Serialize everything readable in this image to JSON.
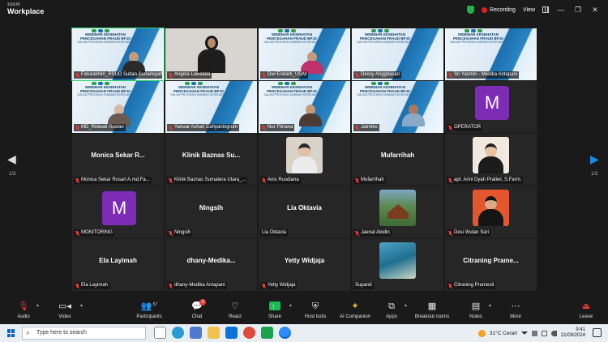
{
  "window": {
    "brand_line1": "zoom",
    "brand_line2": "Workplace",
    "recording_label": "Recording",
    "view_label": "View",
    "minimize_glyph": "—",
    "maximize_glyph": "❐",
    "close_glyph": "✕"
  },
  "navigation": {
    "left_arrow": "◀",
    "right_arrow": "▶",
    "page_left": "1/3",
    "page_right": "1/3"
  },
  "banner": {
    "line1": "WEBINAR KESEHATAN",
    "line2": "PENCEGAHAN FRAUD BPJS",
    "line3": "DALAM PROGRAM JAMINAN KESEHATAN"
  },
  "tiles": [
    {
      "name": "Faturakhim_RSUD Sultan Suriansyah"
    },
    {
      "name": "Angela Lawalata"
    },
    {
      "name": "Dwi Endarti_UGM"
    },
    {
      "name": "Dessy Anggitasari"
    },
    {
      "name": "Sri Yasmin - Medika Antapani"
    },
    {
      "name": "MD_Ridwati Ruslan"
    },
    {
      "name": "Yanuar Ashari Cahyaningrum"
    },
    {
      "name": "Nur Fitriana"
    },
    {
      "name": "Jatmiko"
    },
    {
      "name": "OPERATOR",
      "avatar": "M"
    },
    {
      "display": "Monica  Sekar  R...",
      "name": "Monica Sekar Rosari A.md.Fa..."
    },
    {
      "display": "Klinik  Baznas  Su...",
      "name": "Klinik Baznas Sumatera Utara_..."
    },
    {
      "name": "Anis Rusdiana"
    },
    {
      "display": "Mufarrihah",
      "name": "Mufarrihah"
    },
    {
      "name": "apt. Arini Dyah Pratiwi, S.Farm."
    },
    {
      "name": "MONITORING",
      "avatar": "M"
    },
    {
      "display": "Ningsih",
      "name": "Ningsih"
    },
    {
      "display": "Lia  Oktavia",
      "name": "Lia Oktavia"
    },
    {
      "name": "Jaenal Abidin"
    },
    {
      "name": "Desi Wulan Sari"
    },
    {
      "display": "Ela  Layimah",
      "name": "Ela Layimah"
    },
    {
      "display": "dhany-Medika...",
      "name": "dhany-Medika Antapani"
    },
    {
      "display": "Yetty  Widjaja",
      "name": "Yetty Widjaja"
    },
    {
      "name": "Supardi"
    },
    {
      "display": "Citraning  Prame...",
      "name": "Citraning Pramesti"
    }
  ],
  "toolbar": {
    "audio": "Audio",
    "video": "Video",
    "participants": "Participants",
    "participants_count": "57",
    "chat": "Chat",
    "chat_badge": "3",
    "react": "React",
    "share": "Share",
    "host_tools": "Host tools",
    "ai_companion": "AI Companion",
    "apps": "Apps",
    "breakout_rooms": "Breakout rooms",
    "notes": "Notes",
    "more": "More",
    "leave": "Leave"
  },
  "taskbar": {
    "search_placeholder": "Type here to search",
    "weather": "31°C  Cerah",
    "time": "9:41",
    "date": "21/09/2024"
  },
  "colors": {
    "accent_green": "#2fd36b",
    "record_red": "#e02020",
    "avatar_purple": "#7d2cb5",
    "nav_blue": "#1e88e5"
  }
}
